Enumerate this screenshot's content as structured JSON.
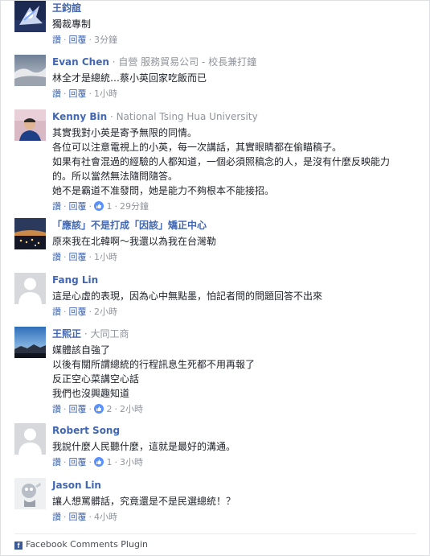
{
  "comments": [
    {
      "author": "王鈞誼",
      "meta": "",
      "text": [
        "獨裁專制"
      ],
      "like_label": "讚",
      "reply_label": "回覆",
      "likes": "",
      "time": "3分鐘"
    },
    {
      "author": "Evan Chen",
      "meta": "自營 服務貿易公司 - 校長兼打鐘",
      "text": [
        "林全才是總統…蔡小英回家吃飯而已"
      ],
      "like_label": "讚",
      "reply_label": "回覆",
      "likes": "",
      "time": "1小時"
    },
    {
      "author": "Kenny Bin",
      "meta": "National Tsing Hua University",
      "text": [
        "其實我對小英是寄予無限的同情。",
        "各位可以注意電視上的小英，每一次講話，其實眼睛都在偷瞄稿子。",
        "如果有社會混過的經驗的人都知道，一個必須照稿念的人，是沒有什麼反映能力",
        "的。所以當然無法隨問隨答。",
        "她不是霸道不准發問，她是能力不夠根本不能接招。"
      ],
      "like_label": "讚",
      "reply_label": "回覆",
      "likes": "1",
      "time": "29分鐘"
    },
    {
      "author": "「應該」不是打成「因該」矯正中心",
      "meta": "",
      "text": [
        "原來我在北韓啊～我還以為我在台灣勒"
      ],
      "like_label": "讚",
      "reply_label": "回覆",
      "likes": "",
      "time": "1小時"
    },
    {
      "author": "Fang Lin",
      "meta": "",
      "text": [
        "這是心虛的表現，因為心中無點墨，怕記者問的問題回答不出來"
      ],
      "like_label": "讚",
      "reply_label": "回覆",
      "likes": "",
      "time": "2小時"
    },
    {
      "author": "王熙正",
      "meta": "大同工商",
      "text": [
        "媒體該自強了",
        "以後有關所謂總統的行程訊息生死都不用再報了",
        "反正空心菜講空心話",
        "我們也沒興趣知道"
      ],
      "like_label": "讚",
      "reply_label": "回覆",
      "likes": "2",
      "time": "2小時"
    },
    {
      "author": "Robert Song",
      "meta": "",
      "text": [
        "我說什麼人民聽什麼，這就是最好的溝通。"
      ],
      "like_label": "讚",
      "reply_label": "回覆",
      "likes": "1",
      "time": "3小時"
    },
    {
      "author": "Jason Lin",
      "meta": "",
      "text": [
        "讓人想罵髒話，究竟還是不是民選總統！？"
      ],
      "like_label": "讚",
      "reply_label": "回覆",
      "likes": "",
      "time": "4小時"
    }
  ],
  "footer": {
    "label": "Facebook Comments Plugin",
    "icon": "facebook-icon"
  },
  "colors": {
    "link": "#4267b2",
    "meta": "#90949c",
    "text": "#1d2129",
    "border": "#dddfe2"
  }
}
